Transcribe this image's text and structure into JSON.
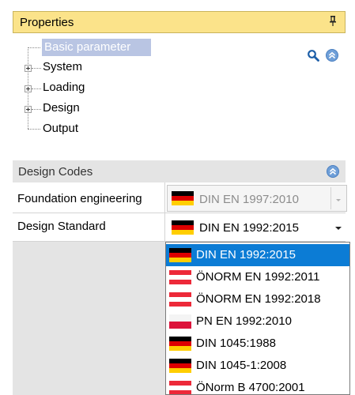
{
  "properties": {
    "title": "Properties",
    "tree": [
      {
        "label": "Basic parameter",
        "selected": true,
        "expandable": false
      },
      {
        "label": "System",
        "expandable": true
      },
      {
        "label": "Loading",
        "expandable": true
      },
      {
        "label": "Design",
        "expandable": true
      },
      {
        "label": "Output",
        "expandable": false
      }
    ]
  },
  "design_codes": {
    "title": "Design Codes",
    "rows": [
      {
        "label": "Foundation engineering",
        "value": "DIN EN 1997:2010",
        "flag": "de",
        "disabled": true
      },
      {
        "label": "Design Standard",
        "value": "DIN EN 1992:2015",
        "flag": "de",
        "disabled": false
      }
    ]
  },
  "dropdown": {
    "selected_index": 0,
    "options": [
      {
        "label": "DIN EN 1992:2015",
        "flag": "de"
      },
      {
        "label": "ÖNORM EN 1992:2011",
        "flag": "at"
      },
      {
        "label": "ÖNORM EN 1992:2018",
        "flag": "at"
      },
      {
        "label": "PN EN 1992:2010",
        "flag": "pl"
      },
      {
        "label": "DIN 1045:1988",
        "flag": "de"
      },
      {
        "label": "DIN 1045-1:2008",
        "flag": "de"
      },
      {
        "label": "ÖNorm B 4700:2001",
        "flag": "at"
      }
    ]
  },
  "colors": {
    "header_bg": "#fbe38a",
    "selection_bg": "#0c7cd5",
    "tree_selection_bg": "#b9c5e3",
    "panel_bg": "#e4e4e4"
  },
  "icons": [
    "pin-icon",
    "search-icon",
    "collapse-icon",
    "expand-plus-icon",
    "chevron-down-icon"
  ]
}
